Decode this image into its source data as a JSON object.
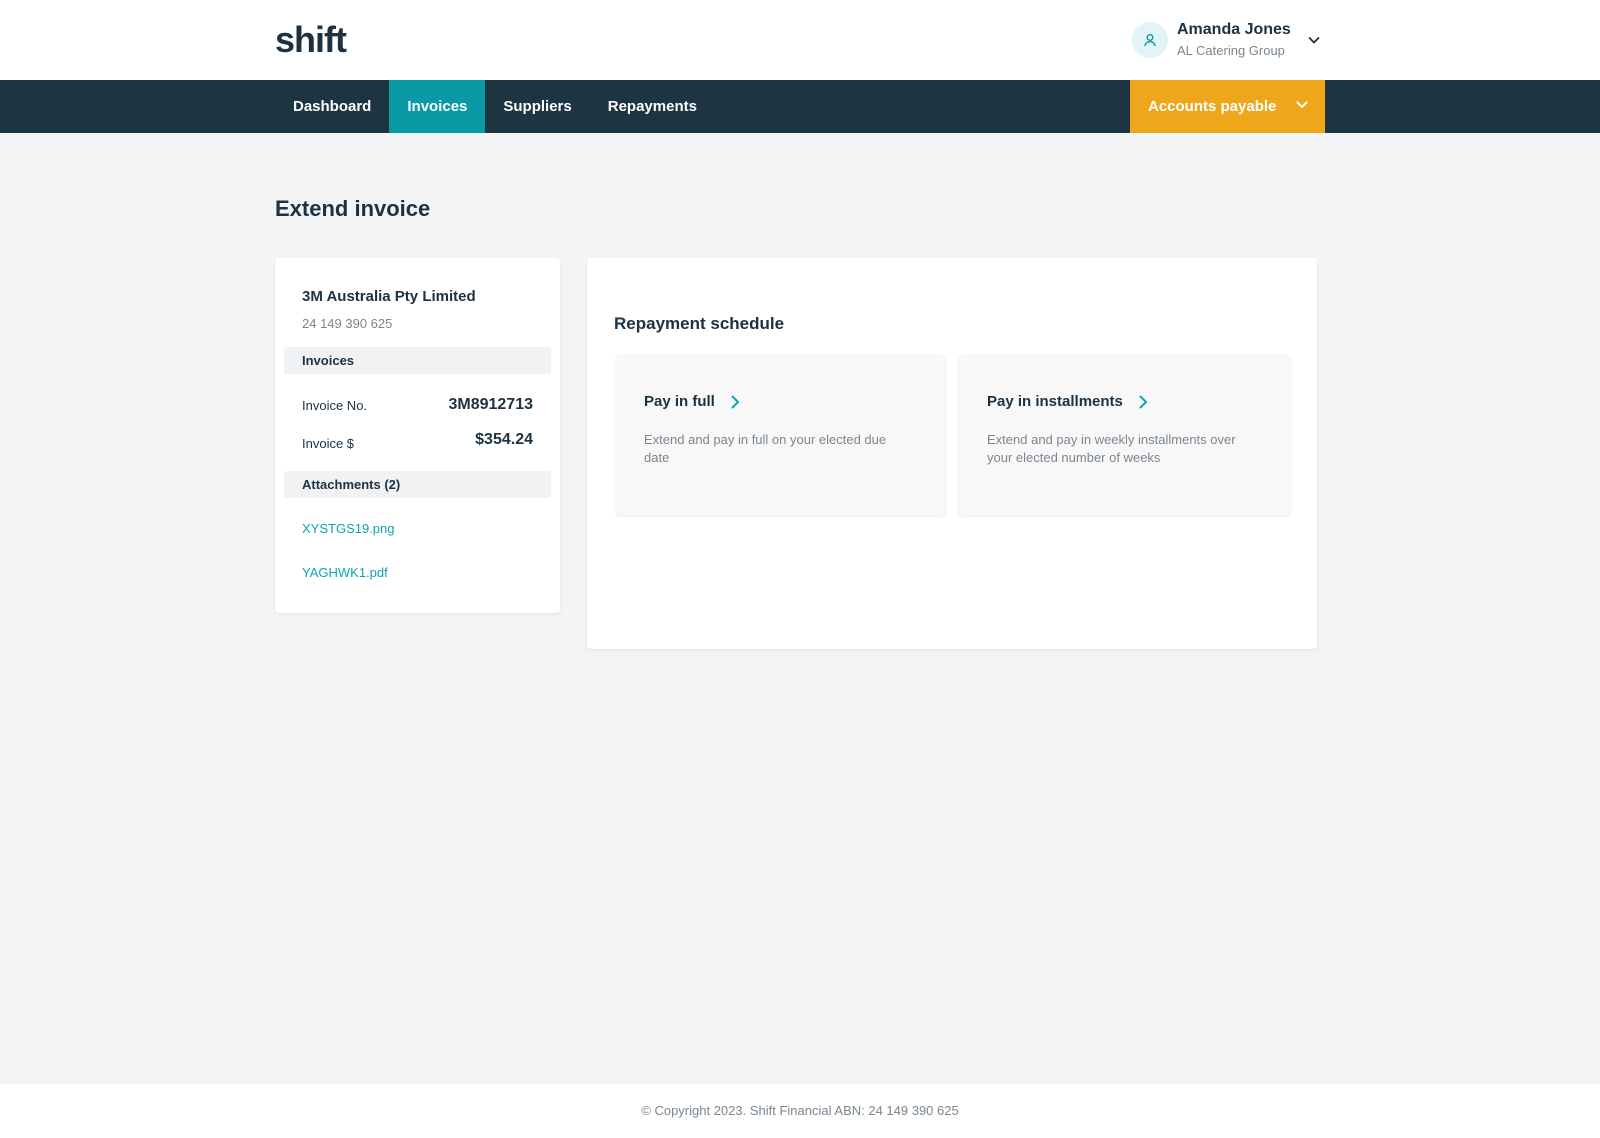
{
  "header": {
    "logo_text": "shift",
    "user": {
      "name": "Amanda Jones",
      "organisation": "AL Catering Group",
      "avatar_icon": "user-icon",
      "dropdown_icon": "chevron-down-icon"
    }
  },
  "nav": {
    "items": [
      {
        "label": "Dashboard",
        "active": false
      },
      {
        "label": "Invoices",
        "active": true
      },
      {
        "label": "Suppliers",
        "active": false
      },
      {
        "label": "Repayments",
        "active": false
      }
    ],
    "account_switch": {
      "label": "Accounts payable",
      "icon": "chevron-down-icon"
    }
  },
  "page": {
    "title": "Extend invoice"
  },
  "supplier_card": {
    "name": "3M Australia Pty Limited",
    "abn": "24 149 390 625",
    "invoices_heading": "Invoices",
    "invoice_no_label": "Invoice No.",
    "invoice_no_value": "3M8912713",
    "invoice_amount_label": "Invoice $",
    "invoice_amount_value": "$354.24",
    "attachments_heading": "Attachments (2)",
    "attachments": [
      "XYSTGS19.png",
      "YAGHWK1.pdf"
    ]
  },
  "repayment": {
    "title": "Repayment schedule",
    "options": [
      {
        "title": "Pay in full",
        "description": "Extend and pay in full on your elected due date",
        "icon": "chevron-right-icon"
      },
      {
        "title": "Pay in installments",
        "description": "Extend and pay in weekly installments over your elected number of weeks",
        "icon": "chevron-right-icon"
      }
    ]
  },
  "footer": {
    "text": "© Copyright 2023. Shift Financial ABN: 24 149 390 625"
  },
  "colors": {
    "nav_bg": "#1d3443",
    "active_tab": "#0a9aa5",
    "accounts_payable_bg": "#eea61b",
    "link": "#0aa5b1",
    "text_dark": "#1c3242",
    "text_muted": "#7a8690",
    "page_bg": "#f3f4f6"
  }
}
